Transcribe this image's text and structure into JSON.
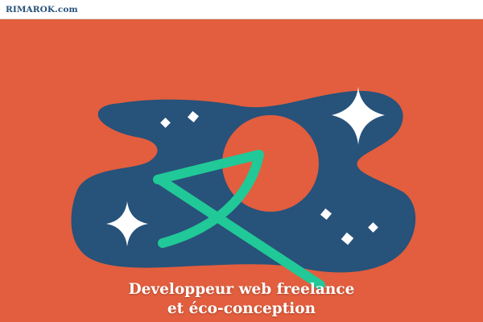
{
  "header": {
    "logo_text": "RIMAROK.com"
  },
  "hero": {
    "tagline_line1": "Developpeur web freelance",
    "tagline_line2": "et éco-conception"
  },
  "colors": {
    "background": "#e25e3e",
    "blob": "#27527a",
    "accent": "#20c997",
    "white": "#ffffff"
  },
  "icons": [
    "sparkle-star-icon",
    "diamond-dot-icon",
    "rk-monogram-icon",
    "circle-planet-icon"
  ]
}
